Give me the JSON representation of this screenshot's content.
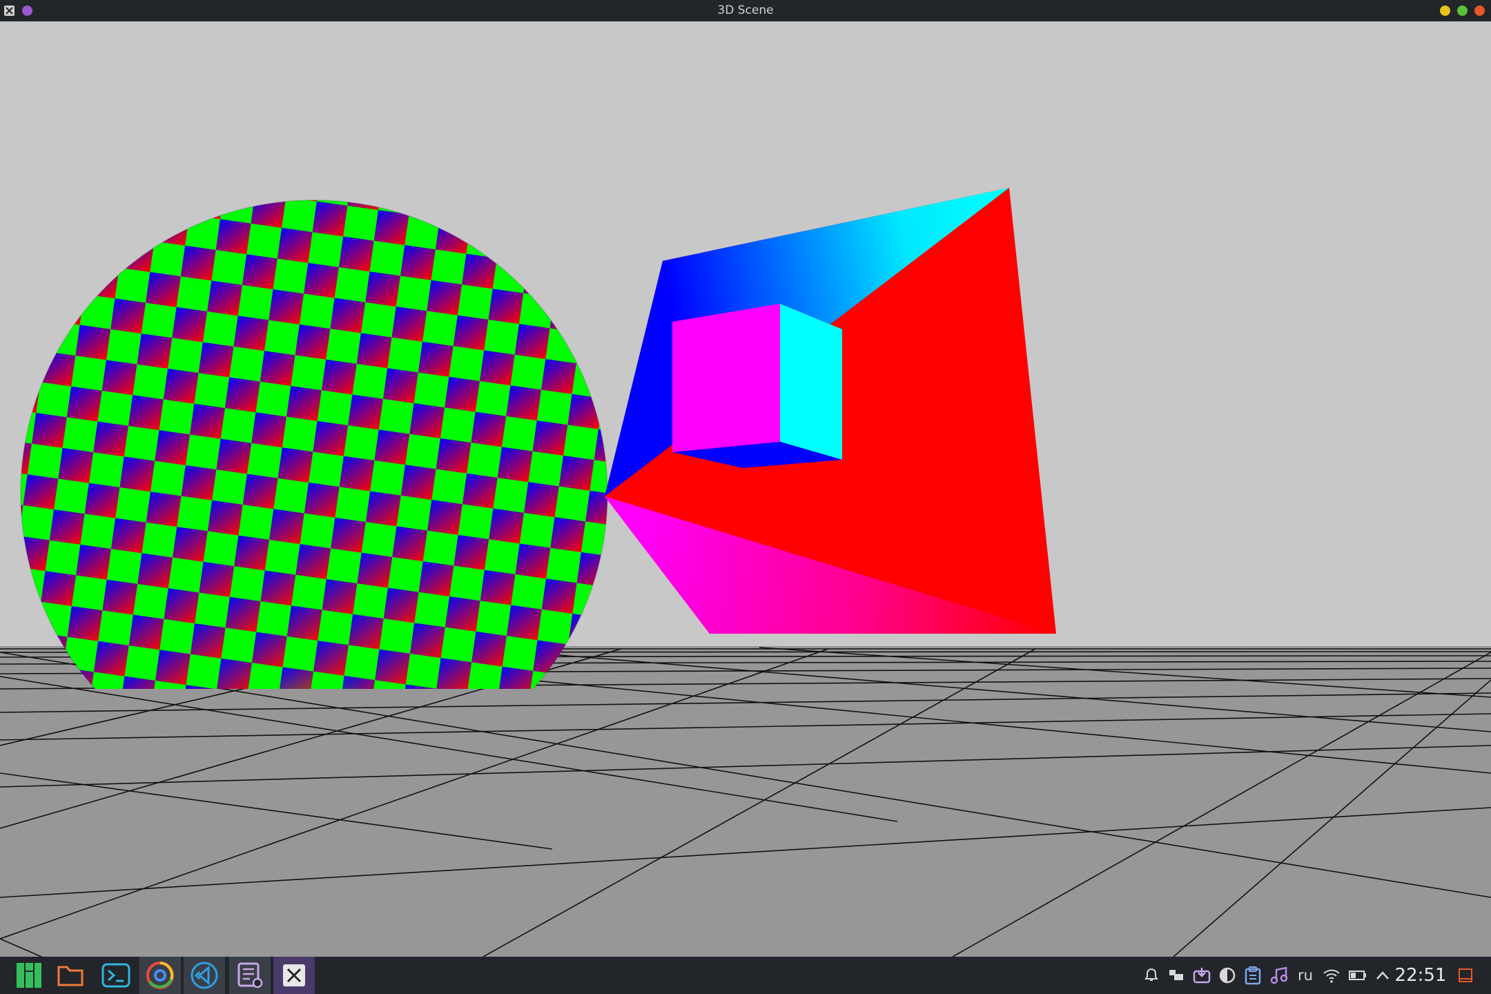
{
  "window": {
    "title": "3D Scene"
  },
  "colors": {
    "title_bar": "#232629",
    "sky": "#c8c8c8",
    "ground": "#979797",
    "grid_line": "#111111",
    "minimize": "#e8c41a",
    "maximize": "#58c23a",
    "close": "#e8562a",
    "taskbar": "#22252a"
  },
  "taskbar": {
    "apps": [
      {
        "name": "manjaro-menu-icon"
      },
      {
        "name": "folder-icon"
      },
      {
        "name": "terminal-icon"
      },
      {
        "name": "chrome-icon"
      },
      {
        "name": "vscode-icon"
      },
      {
        "name": "text-editor-icon"
      },
      {
        "name": "x-window-icon"
      }
    ],
    "tray": {
      "language": "ru",
      "clock": "22:51"
    }
  }
}
